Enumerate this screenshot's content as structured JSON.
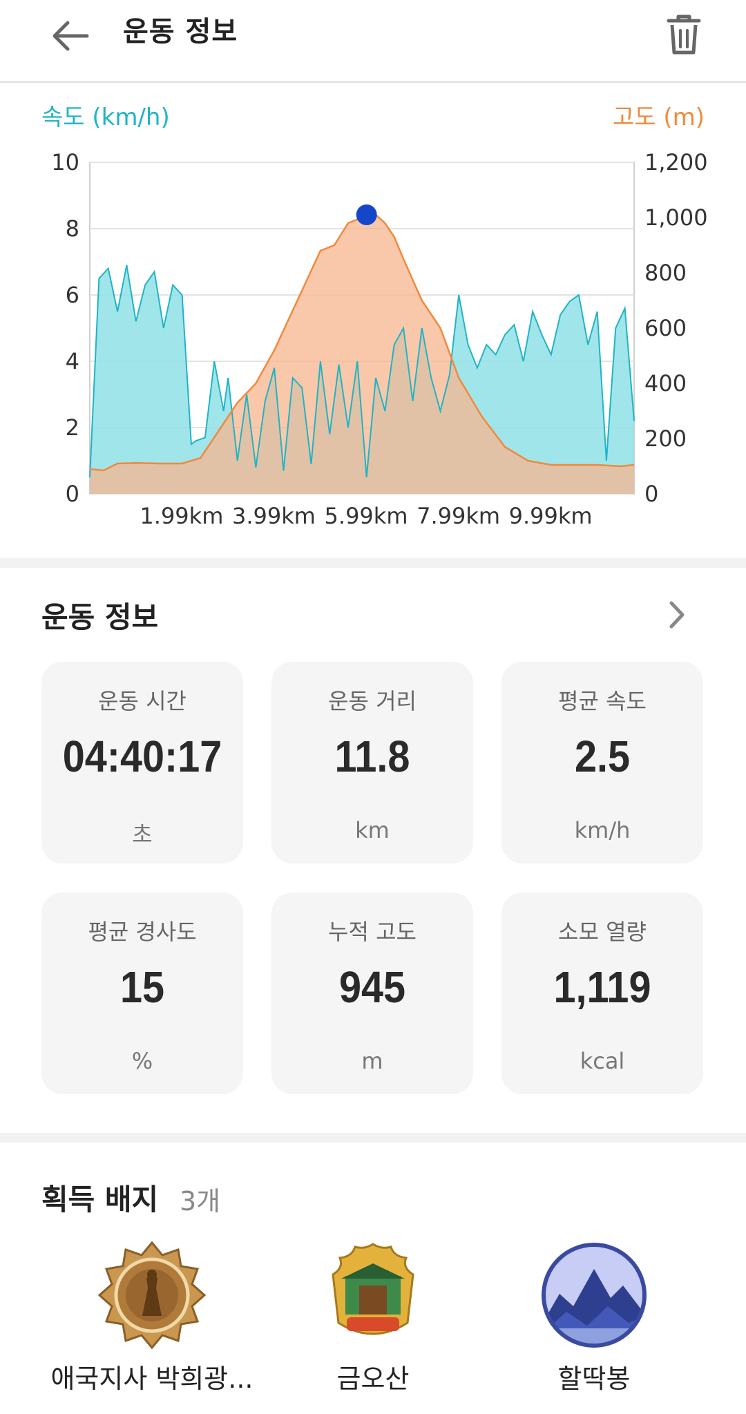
{
  "header": {
    "title": "운동 정보"
  },
  "chart": {
    "left_axis_title": "속도 (km/h)",
    "right_axis_title": "고도 (m)",
    "colors": {
      "speed": "#1fb4c6",
      "speed_fill": "#8fe0e6",
      "altitude": "#f08a3c",
      "altitude_fill": "#f7b58f",
      "marker": "#1546c9"
    }
  },
  "chart_data": {
    "type": "area",
    "x_tick_labels": [
      "1.99km",
      "3.99km",
      "5.99km",
      "7.99km",
      "9.99km"
    ],
    "y_left": {
      "label": "속도 (km/h)",
      "ticks": [
        "0",
        "2",
        "4",
        "6",
        "8",
        "10"
      ],
      "range": [
        0,
        10
      ]
    },
    "y_right": {
      "label": "고도 (m)",
      "ticks": [
        "0",
        "200",
        "400",
        "600",
        "800",
        "1,000",
        "1,200"
      ],
      "range": [
        0,
        1200
      ]
    },
    "x_range_km": [
      0,
      11.8
    ],
    "series": [
      {
        "name": "속도 (km/h)",
        "axis": "left",
        "x": [
          0,
          0.2,
          0.4,
          0.6,
          0.8,
          1.0,
          1.2,
          1.4,
          1.6,
          1.8,
          2.0,
          2.2,
          2.3,
          2.5,
          2.7,
          2.9,
          3.0,
          3.2,
          3.4,
          3.6,
          3.8,
          4.0,
          4.2,
          4.4,
          4.6,
          4.8,
          5.0,
          5.2,
          5.4,
          5.6,
          5.8,
          6.0,
          6.2,
          6.4,
          6.6,
          6.8,
          7.0,
          7.2,
          7.4,
          7.6,
          7.8,
          8.0,
          8.2,
          8.4,
          8.6,
          8.8,
          9.0,
          9.2,
          9.4,
          9.6,
          9.8,
          10.0,
          10.2,
          10.4,
          10.6,
          10.8,
          11.0,
          11.2,
          11.4,
          11.6,
          11.8
        ],
        "values": [
          0.5,
          6.5,
          6.8,
          5.5,
          6.9,
          5.2,
          6.3,
          6.7,
          5.0,
          6.3,
          6.0,
          1.5,
          1.6,
          1.7,
          4.0,
          2.5,
          3.5,
          1.0,
          3.0,
          0.8,
          2.8,
          3.8,
          0.7,
          3.5,
          3.2,
          0.9,
          4.0,
          1.8,
          3.9,
          2.0,
          4.0,
          0.5,
          3.5,
          2.5,
          4.5,
          5.0,
          2.8,
          5.0,
          3.5,
          2.5,
          3.6,
          6.0,
          4.5,
          3.8,
          4.5,
          4.2,
          4.8,
          5.1,
          4.0,
          5.5,
          4.8,
          4.2,
          5.4,
          5.8,
          6.0,
          4.5,
          5.5,
          1.0,
          5.0,
          5.6,
          2.2
        ]
      },
      {
        "name": "고도 (m)",
        "axis": "right",
        "x": [
          0,
          0.3,
          0.6,
          1.0,
          1.5,
          2.0,
          2.4,
          2.8,
          3.2,
          3.6,
          4.0,
          4.5,
          5.0,
          5.3,
          5.6,
          5.9,
          6.2,
          6.4,
          6.6,
          6.8,
          7.2,
          7.6,
          8.0,
          8.5,
          9.0,
          9.5,
          10.0,
          10.5,
          11.0,
          11.5,
          11.8
        ],
        "values": [
          90,
          85,
          110,
          112,
          110,
          110,
          130,
          230,
          330,
          400,
          520,
          700,
          880,
          900,
          980,
          1000,
          1010,
          980,
          930,
          850,
          700,
          600,
          420,
          280,
          170,
          120,
          105,
          105,
          105,
          100,
          105
        ]
      }
    ],
    "marker": {
      "x": 6.0,
      "y_altitude": 1010
    },
    "grid": true
  },
  "summary": {
    "heading": "운동 정보",
    "tiles": [
      {
        "label": "운동 시간",
        "value": "04:40:17",
        "unit": "초"
      },
      {
        "label": "운동 거리",
        "value": "11.8",
        "unit": "km"
      },
      {
        "label": "평균 속도",
        "value": "2.5",
        "unit": "km/h"
      },
      {
        "label": "평균 경사도",
        "value": "15",
        "unit": "%"
      },
      {
        "label": "누적 고도",
        "value": "945",
        "unit": "m"
      },
      {
        "label": "소모 열량",
        "value": "1,119",
        "unit": "kcal"
      }
    ]
  },
  "badges": {
    "heading": "획득 배지",
    "count": "3개",
    "items": [
      {
        "name": "애국지사 박희광...",
        "icon": "medal-badge-icon"
      },
      {
        "name": "금오산",
        "icon": "gate-badge-icon"
      },
      {
        "name": "할딱봉",
        "icon": "mountain-badge-icon"
      }
    ]
  },
  "icons": {
    "back": "arrow-left-icon",
    "delete": "trash-icon",
    "more": "chevron-right-icon"
  }
}
